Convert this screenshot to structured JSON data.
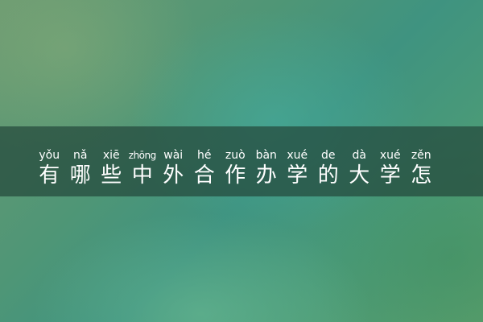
{
  "title": {
    "chars": [
      {
        "pinyin": "yǒu",
        "hanzi": "有"
      },
      {
        "pinyin": "nǎ",
        "hanzi": "哪"
      },
      {
        "pinyin": "xiē",
        "hanzi": "些"
      },
      {
        "pinyin": "zhōng",
        "hanzi": "中"
      },
      {
        "pinyin": "wài",
        "hanzi": "外"
      },
      {
        "pinyin": "hé",
        "hanzi": "合"
      },
      {
        "pinyin": "zuò",
        "hanzi": "作"
      },
      {
        "pinyin": "bàn",
        "hanzi": "办"
      },
      {
        "pinyin": "xué",
        "hanzi": "学"
      },
      {
        "pinyin": "de",
        "hanzi": "的"
      },
      {
        "pinyin": "dà",
        "hanzi": "大"
      },
      {
        "pinyin": "xué",
        "hanzi": "学"
      },
      {
        "pinyin": "zěn",
        "hanzi": "怎"
      }
    ]
  }
}
